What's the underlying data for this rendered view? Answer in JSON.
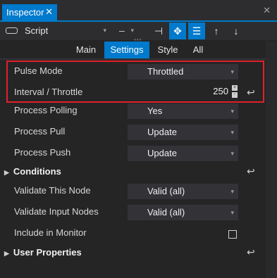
{
  "window": {
    "tab_title": "Inspector",
    "tab_close": "✕",
    "close": "✕"
  },
  "toolbar": {
    "selector_value": "Script",
    "selector_arrow": "▾",
    "minus_value": "–",
    "minus_arrow": "▾",
    "grip": "•••",
    "buttons": [
      {
        "name": "pin",
        "glyph": "⊣",
        "active": false
      },
      {
        "name": "locate",
        "glyph": "✥",
        "active": true
      },
      {
        "name": "list",
        "glyph": "☰",
        "active": true
      },
      {
        "name": "move-up",
        "glyph": "↑",
        "active": false
      },
      {
        "name": "move-down",
        "glyph": "↓",
        "active": false
      }
    ]
  },
  "subtabs": [
    {
      "label": "Main",
      "active": false
    },
    {
      "label": "Settings",
      "active": true
    },
    {
      "label": "Style",
      "active": false
    },
    {
      "label": "All",
      "active": false
    }
  ],
  "properties": {
    "pulse_mode": {
      "label": "Pulse Mode",
      "value": "Throttled"
    },
    "interval": {
      "label": "Interval / Throttle",
      "value": "250"
    },
    "process_polling": {
      "label": "Process Polling",
      "value": "Yes"
    },
    "process_pull": {
      "label": "Process Pull",
      "value": "Update"
    },
    "process_push": {
      "label": "Process Push",
      "value": "Update"
    },
    "conditions": {
      "label": "Conditions"
    },
    "validate_this_node": {
      "label": "Validate This Node",
      "value": "Valid (all)"
    },
    "validate_input_nodes": {
      "label": "Validate Input Nodes",
      "value": "Valid (all)"
    },
    "include_in_monitor": {
      "label": "Include in Monitor",
      "checked": false
    },
    "user_properties": {
      "label": "User Properties"
    }
  },
  "glyphs": {
    "dropdown_arrow": "▾",
    "return": "↩",
    "expand": "▶",
    "spin_up": "+",
    "spin_down": "-"
  },
  "colors": {
    "accent": "#007acc",
    "highlight": "#e0202a",
    "background": "#252526"
  }
}
